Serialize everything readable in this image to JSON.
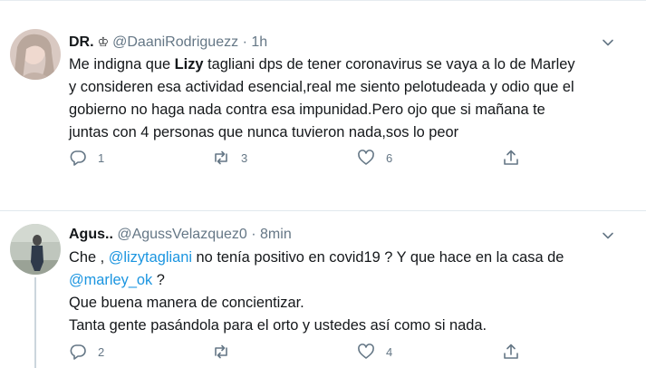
{
  "tweets": [
    {
      "author_name": "DR.",
      "author_badge": "♔",
      "handle": "@DaaniRodriguezz",
      "separator": "·",
      "time": "1h",
      "body": {
        "l1_a": "Me indigna que ",
        "l1_bold": "Lizy",
        "l1_b": " tagliani dps de tener coronavirus se vaya a lo de Marley",
        "l2": "y consideren esa actividad esencial,real me siento pelotudeada y odio que el",
        "l3": "gobierno no haga nada contra esa impunidad.Pero ojo que si mañana te",
        "l4": "juntas con 4 personas que nunca tuvieron nada,sos lo peor"
      },
      "replies": "1",
      "retweets": "3",
      "likes": "6"
    },
    {
      "author_name": "Agus..",
      "handle": "@AgussVelazquez0",
      "separator": "·",
      "time": "8min",
      "body": {
        "l1_a": "Che , ",
        "l1_mention": "@lizytagliani",
        "l1_b": " no tenía positivo en covid19 ? Y que hace en la casa de",
        "l2_mention": "@marley_ok",
        "l2_b": " ?",
        "l3": "Que buena manera de concientizar.",
        "l4": "Tanta gente pasándola para el orto y ustedes así como si nada."
      },
      "replies": "2",
      "retweets": "",
      "likes": "4"
    }
  ],
  "icons": {
    "reply": "reply-icon",
    "retweet": "retweet-icon",
    "like": "heart-icon",
    "share": "share-icon",
    "menu": "chevron-down-icon"
  },
  "colors": {
    "text": "#14171a",
    "secondary": "#657786",
    "link": "#1b95e0",
    "divider": "#e1e8ed"
  }
}
